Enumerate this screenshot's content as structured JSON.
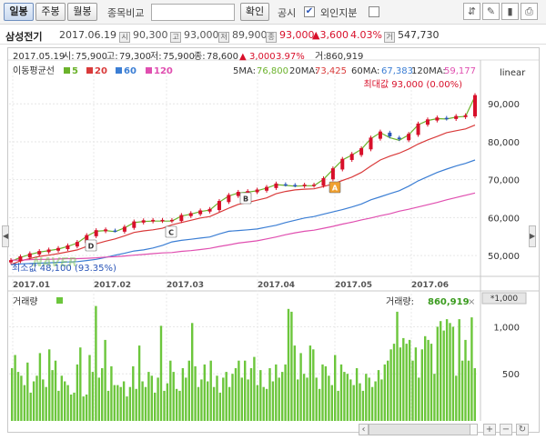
{
  "toolbar": {
    "tabs": [
      "일봉",
      "주봉",
      "월봉"
    ],
    "compare_label": "종목비교",
    "compare_value": "",
    "confirm_button": "확인",
    "disclosure_label": "공시",
    "disclosure_checked": true,
    "foreign_label": "외인지분",
    "foreign_checked": false
  },
  "stock": {
    "name": "삼성전기",
    "date": "2017.06.19",
    "open_icon": "시",
    "open": "90,300",
    "high_icon": "고",
    "high": "93,000",
    "low_icon": "저",
    "low": "89,900",
    "close_icon": "종",
    "close": "93,000",
    "change": "▲3,600",
    "change_pct": "4.03%",
    "volume_icon": "거",
    "volume": "547,730"
  },
  "chart_header": {
    "row": [
      "2017.05.19",
      "시:",
      "75,900",
      "고:",
      "79,300",
      "저:",
      "75,900",
      "종:",
      "78,600",
      "▲",
      "3,000",
      "3.97%",
      "거:",
      "860,919"
    ]
  },
  "legend": {
    "title": "이동평균선",
    "items": [
      {
        "label": "5",
        "color": "#6bb22b"
      },
      {
        "label": "20",
        "color": "#d93a3a"
      },
      {
        "label": "60",
        "color": "#3b7ed4"
      },
      {
        "label": "120",
        "color": "#e04fb0"
      }
    ],
    "ma_labels": [
      "5MA:",
      "20MA:",
      "60MA:",
      "120MA:"
    ],
    "ma_values": [
      "76,800",
      "73,425",
      "67,383",
      "59,177"
    ]
  },
  "scale_label": "linear",
  "annotations": {
    "max": "최대값 93,000 (0.00%)",
    "min": "최소값 48,100 (93.35%)",
    "markers": [
      "A",
      "B",
      "C",
      "D"
    ],
    "watermark": "NAVER"
  },
  "volume_panel": {
    "title": "거래량",
    "value_label": "거래량:",
    "value": "860,919",
    "unit": "*1,000"
  },
  "colors": {
    "up": "#d8102a",
    "down": "#2a55b8",
    "ma5": "#6bb22b",
    "ma20": "#d93a3a",
    "ma60": "#3b7ed4",
    "ma120": "#e04fb0",
    "volume": "#6cc63c"
  },
  "chart_data": [
    {
      "type": "line",
      "title": "",
      "xlabel": "",
      "ylabel": "",
      "x_ticks": [
        "2017.01",
        "2017.02",
        "2017.03",
        "2017.04",
        "2017.05",
        "2017.06"
      ],
      "y_ticks": [
        "50,000",
        "60,000",
        "70,000",
        "80,000",
        "90,000"
      ],
      "ylim": [
        45000,
        97000
      ],
      "grid": true,
      "series": [
        {
          "name": "5",
          "values": [
            48500,
            49500,
            50300,
            50900,
            51300,
            51700,
            52400,
            53300,
            55100,
            56400,
            56600,
            56300,
            57300,
            58700,
            59000,
            59100,
            59100,
            59100,
            60400,
            60900,
            61600,
            62000,
            64100,
            65700,
            66500,
            66700,
            67100,
            67800,
            68700,
            68500,
            68300,
            68400,
            68400,
            70100,
            72700,
            75200,
            76500,
            78000,
            80800,
            82400,
            81100,
            80400,
            81800,
            84500,
            85600,
            86100,
            86000,
            86500,
            86700,
            92000
          ]
        },
        {
          "name": "20",
          "values": [
            47600,
            48600,
            49200,
            49800,
            50100,
            50500,
            51000,
            51500,
            52400,
            53100,
            53800,
            54400,
            55200,
            56100,
            56500,
            56800,
            57200,
            58100,
            58700,
            59300,
            59900,
            60300,
            61400,
            62500,
            63500,
            64000,
            64600,
            65200,
            66300,
            66900,
            67300,
            67500,
            67600,
            68200,
            68900,
            69800,
            70700,
            71900,
            73600,
            75200,
            76200,
            77000,
            78100,
            79400,
            80500,
            81400,
            82400,
            82900,
            83400,
            84400
          ]
        },
        {
          "name": "60",
          "values": [
            47600,
            47800,
            47900,
            48000,
            48100,
            48200,
            48300,
            48400,
            48700,
            49000,
            49500,
            50100,
            50600,
            51200,
            51500,
            52000,
            52700,
            53600,
            54000,
            54300,
            54600,
            54900,
            55700,
            56400,
            56600,
            56800,
            57000,
            57500,
            58000,
            58700,
            59300,
            59900,
            60300,
            60900,
            61500,
            62100,
            62800,
            63600,
            64700,
            65500,
            66300,
            67100,
            68300,
            69700,
            70800,
            71900,
            72800,
            73600,
            74300,
            75200
          ]
        },
        {
          "name": "120",
          "values": [
            48800,
            48800,
            48900,
            49000,
            49000,
            49100,
            49200,
            49200,
            49300,
            49400,
            49600,
            49700,
            49900,
            50100,
            50300,
            50500,
            50700,
            50800,
            51100,
            51300,
            51600,
            51900,
            52400,
            52800,
            53300,
            53600,
            53900,
            54400,
            54900,
            55500,
            56000,
            56400,
            56700,
            57200,
            57700,
            58300,
            58800,
            59400,
            59900,
            60500,
            61000,
            61700,
            62200,
            62800,
            63400,
            64000,
            64700,
            65300,
            65900,
            66500
          ]
        }
      ]
    },
    {
      "type": "bar",
      "title": "",
      "ylabel": "거래량 (*1,000)",
      "y_ticks": [
        "500",
        "1,000"
      ],
      "ylim": [
        0,
        1400
      ],
      "values": [
        560,
        700,
        520,
        480,
        380,
        620,
        300,
        420,
        480,
        720,
        440,
        360,
        760,
        540,
        640,
        320,
        480,
        420,
        380,
        280,
        300,
        600,
        780,
        260,
        280,
        700,
        520,
        1220,
        460,
        560,
        860,
        320,
        580,
        380,
        380,
        360,
        420,
        260,
        360,
        580,
        340,
        800,
        420,
        360,
        520,
        480,
        300,
        460,
        1010,
        320,
        400,
        640,
        520,
        340,
        320,
        560,
        460,
        640,
        1040,
        580,
        360,
        440,
        600,
        420,
        640,
        360,
        480,
        300,
        460,
        520,
        360,
        500,
        560,
        640,
        460,
        640,
        440,
        560,
        680,
        380,
        540,
        360,
        340,
        560,
        420,
        600,
        460,
        520,
        600,
        1190,
        1160,
        800,
        440,
        720,
        500,
        460,
        800,
        760,
        460,
        340,
        600,
        580,
        480,
        380,
        700,
        320,
        600,
        520,
        500,
        440,
        380,
        560,
        400,
        320,
        500,
        460,
        360,
        420,
        540,
        440,
        600,
        640,
        760,
        820,
        1160,
        780,
        880,
        820,
        860,
        640,
        780,
        460,
        760,
        900,
        860,
        820,
        500,
        1000,
        1060,
        960,
        1080,
        1040,
        1000,
        480,
        1080,
        640,
        860,
        640,
        1100,
        560
      ]
    }
  ]
}
